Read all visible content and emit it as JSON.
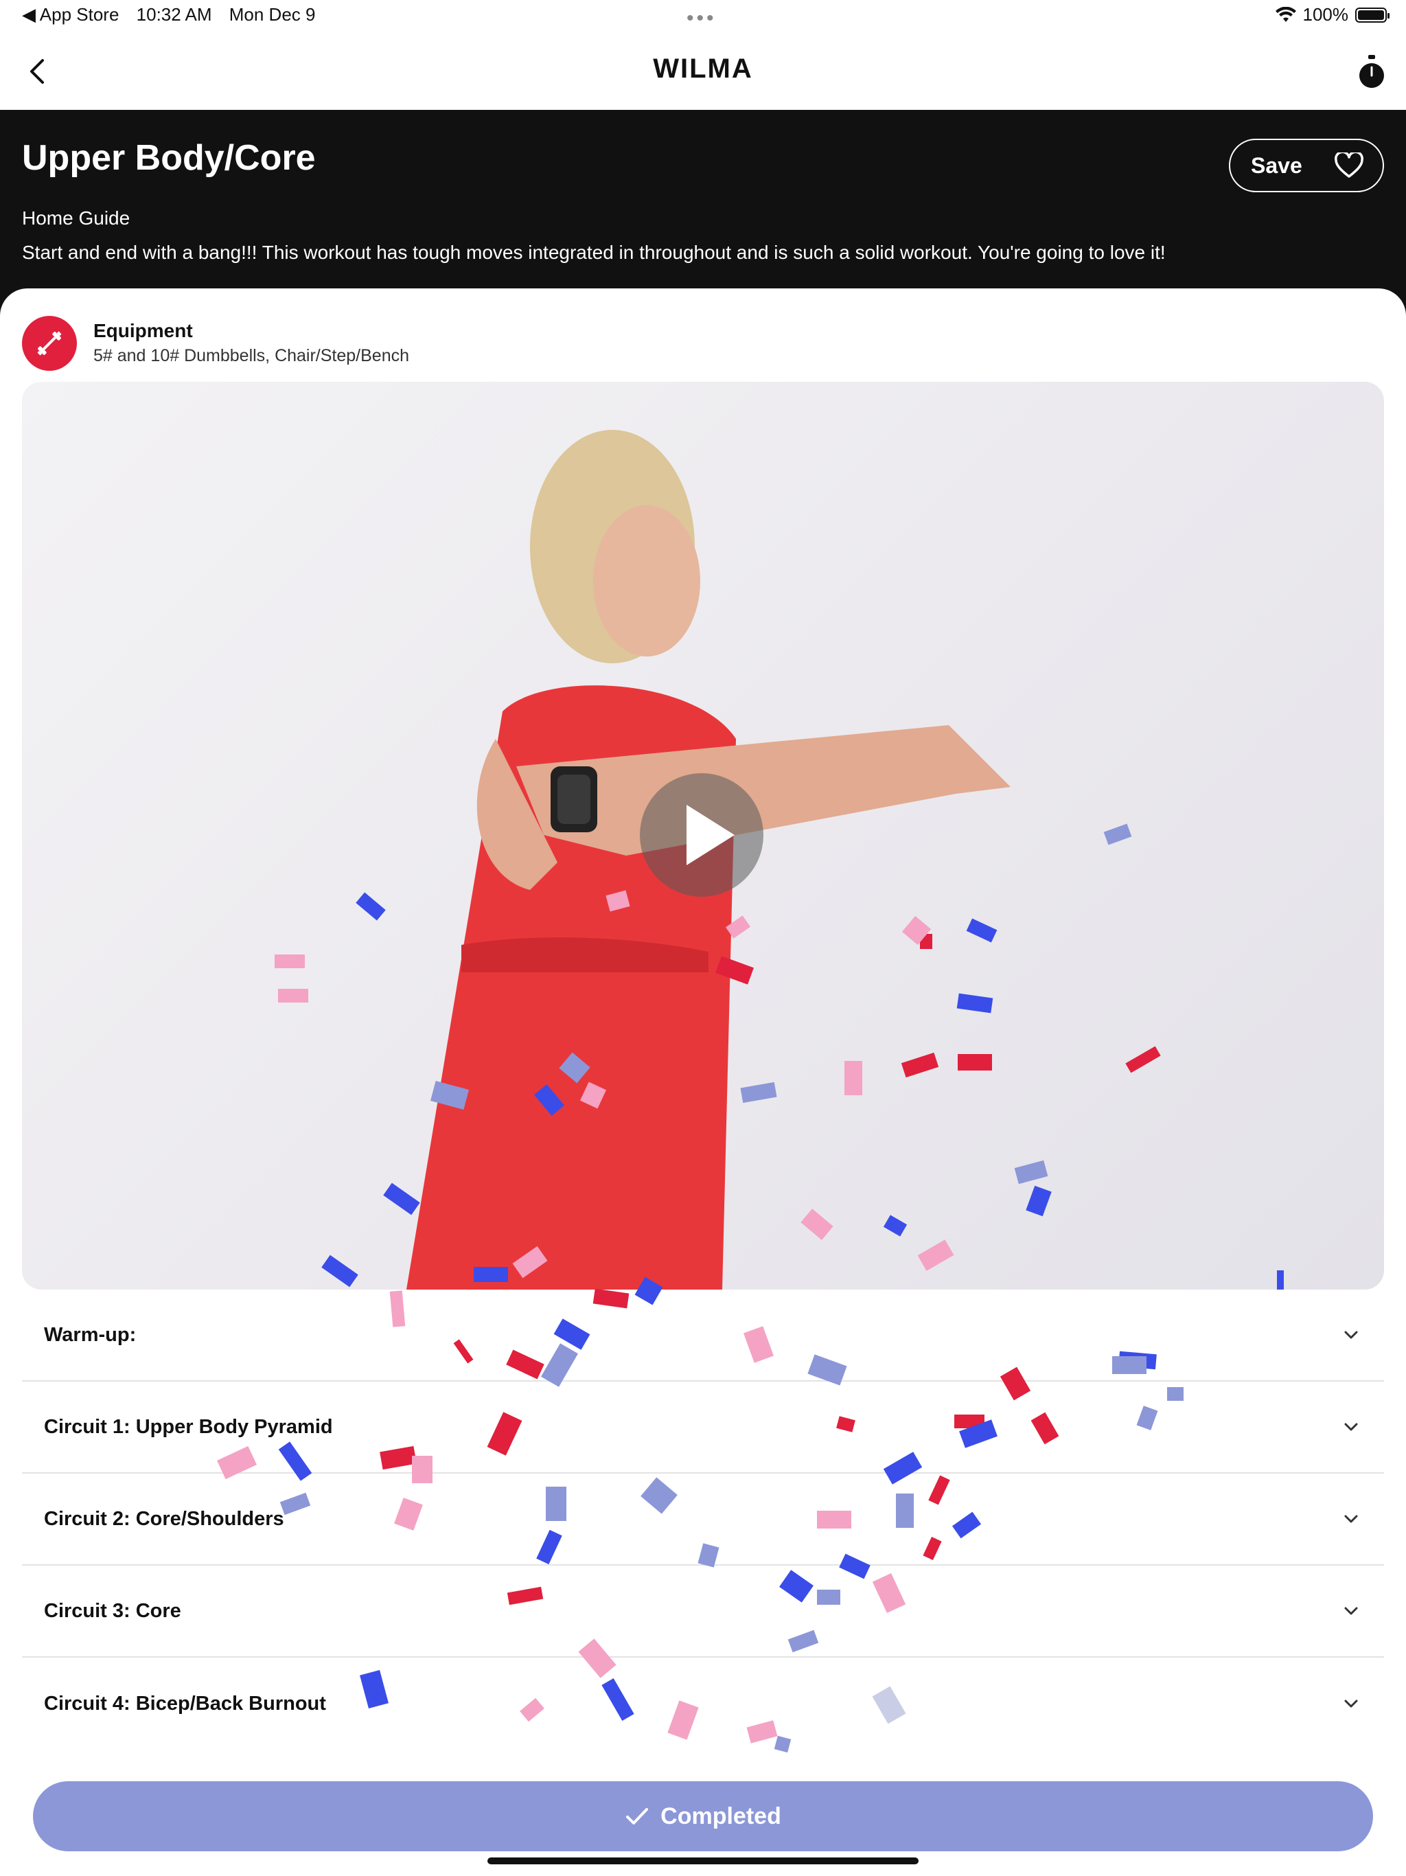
{
  "status_bar": {
    "back_app": "◀ App Store",
    "time": "10:32 AM",
    "date": "Mon Dec 9",
    "more": "•••",
    "battery": "100%"
  },
  "nav": {
    "brand": "WILMA",
    "back_icon": "chevron-left-icon",
    "timer_icon": "stopwatch-icon"
  },
  "workout": {
    "title": "Upper Body/Core",
    "save_label": "Save",
    "guide": "Home Guide",
    "description": "Start and end with a bang!!! This workout has tough moves integrated in throughout and is such a solid workout. You're going to love it!"
  },
  "equipment": {
    "title": "Equipment",
    "items": "5# and 10# Dumbbells, Chair/Step/Bench",
    "icon": "dumbbell-icon"
  },
  "sections": [
    {
      "label": "Warm-up:"
    },
    {
      "label": "Circuit 1: Upper Body Pyramid"
    },
    {
      "label": "Circuit 2: Core/Shoulders"
    },
    {
      "label": "Circuit 3: Core"
    },
    {
      "label": "Circuit 4: Bicep/Back Burnout"
    }
  ],
  "completed_label": "Completed",
  "colors": {
    "accent_red": "#e0203c",
    "completed_purple": "#8c97d8",
    "hero_bg": "#111111"
  }
}
